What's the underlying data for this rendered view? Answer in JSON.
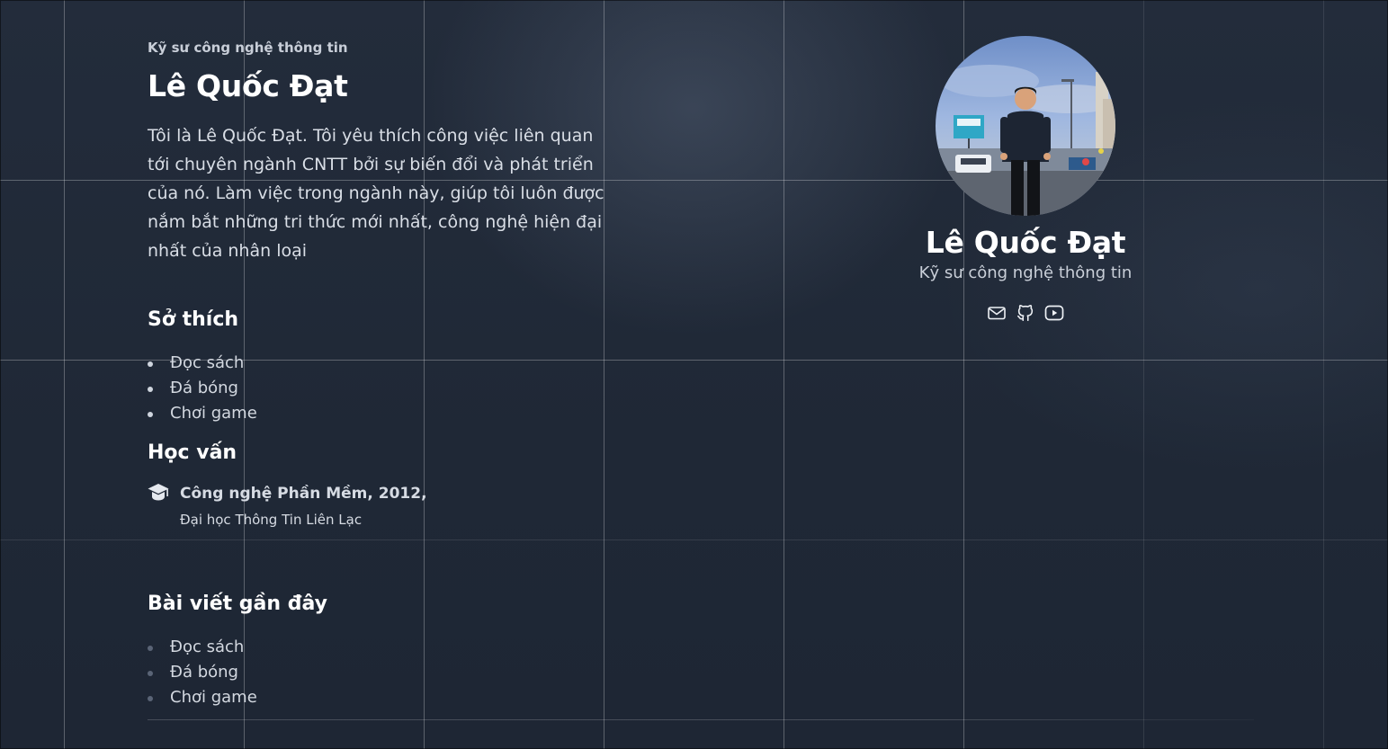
{
  "header": {
    "kicker": "Kỹ sư công nghệ thông tin",
    "name": "Lê Quốc Đạt",
    "about": "Tôi là Lê Quốc Đạt. Tôi yêu thích công việc liên quan tới chuyên ngành CNTT bởi sự biến đổi và phát triển của nó. Làm việc trong ngành này, giúp tôi luôn được nắm bắt những tri thức mới nhất, công nghệ hiện đại nhất của nhân loại"
  },
  "hobbies": {
    "heading": "Sở thích",
    "items": [
      "Đọc sách",
      "Đá bóng",
      "Chơi game"
    ]
  },
  "education": {
    "heading": "Học vấn",
    "icon": "graduation-cap-icon",
    "degree": "Công nghệ Phần Mềm, 2012,",
    "school": "Đại học Thông Tin Liên Lạc"
  },
  "posts": {
    "heading": "Bài viết gần đây",
    "items": [
      "Đọc sách",
      "Đá bóng",
      "Chơi game"
    ]
  },
  "profile": {
    "name": "Lê Quốc Đạt",
    "role": "Kỹ sư công nghệ thông tin",
    "socials": [
      "mail-icon",
      "github-icon",
      "youtube-icon"
    ]
  },
  "colors": {
    "background": "#1f2837",
    "heading": "#ffffff",
    "text": "#d3d8e0"
  }
}
